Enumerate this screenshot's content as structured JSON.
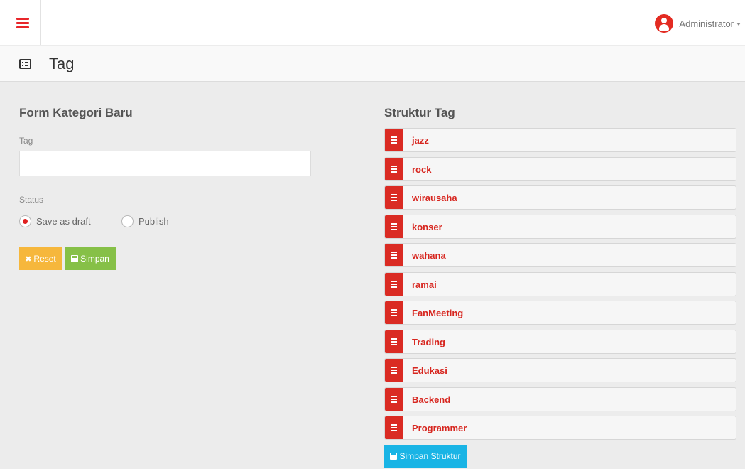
{
  "header": {
    "user_name": "Administrator"
  },
  "page": {
    "title": "Tag"
  },
  "form": {
    "title": "Form Kategori Baru",
    "tag_label": "Tag",
    "tag_value": "",
    "status_label": "Status",
    "status_options": [
      {
        "label": "Save as draft",
        "checked": true
      },
      {
        "label": "Publish",
        "checked": false
      }
    ],
    "reset_label": "Reset",
    "save_label": "Simpan"
  },
  "structure": {
    "title": "Struktur Tag",
    "tags": [
      "jazz",
      "rock",
      "wirausaha",
      "konser",
      "wahana",
      "ramai",
      "FanMeeting",
      "Trading",
      "Edukasi",
      "Backend",
      "Programmer"
    ],
    "save_label": "Simpan Struktur"
  },
  "colors": {
    "accent_red": "#da2b23",
    "reset_button": "#f6b73c",
    "save_button": "#86c047",
    "save_structure_button": "#19b4e5"
  }
}
